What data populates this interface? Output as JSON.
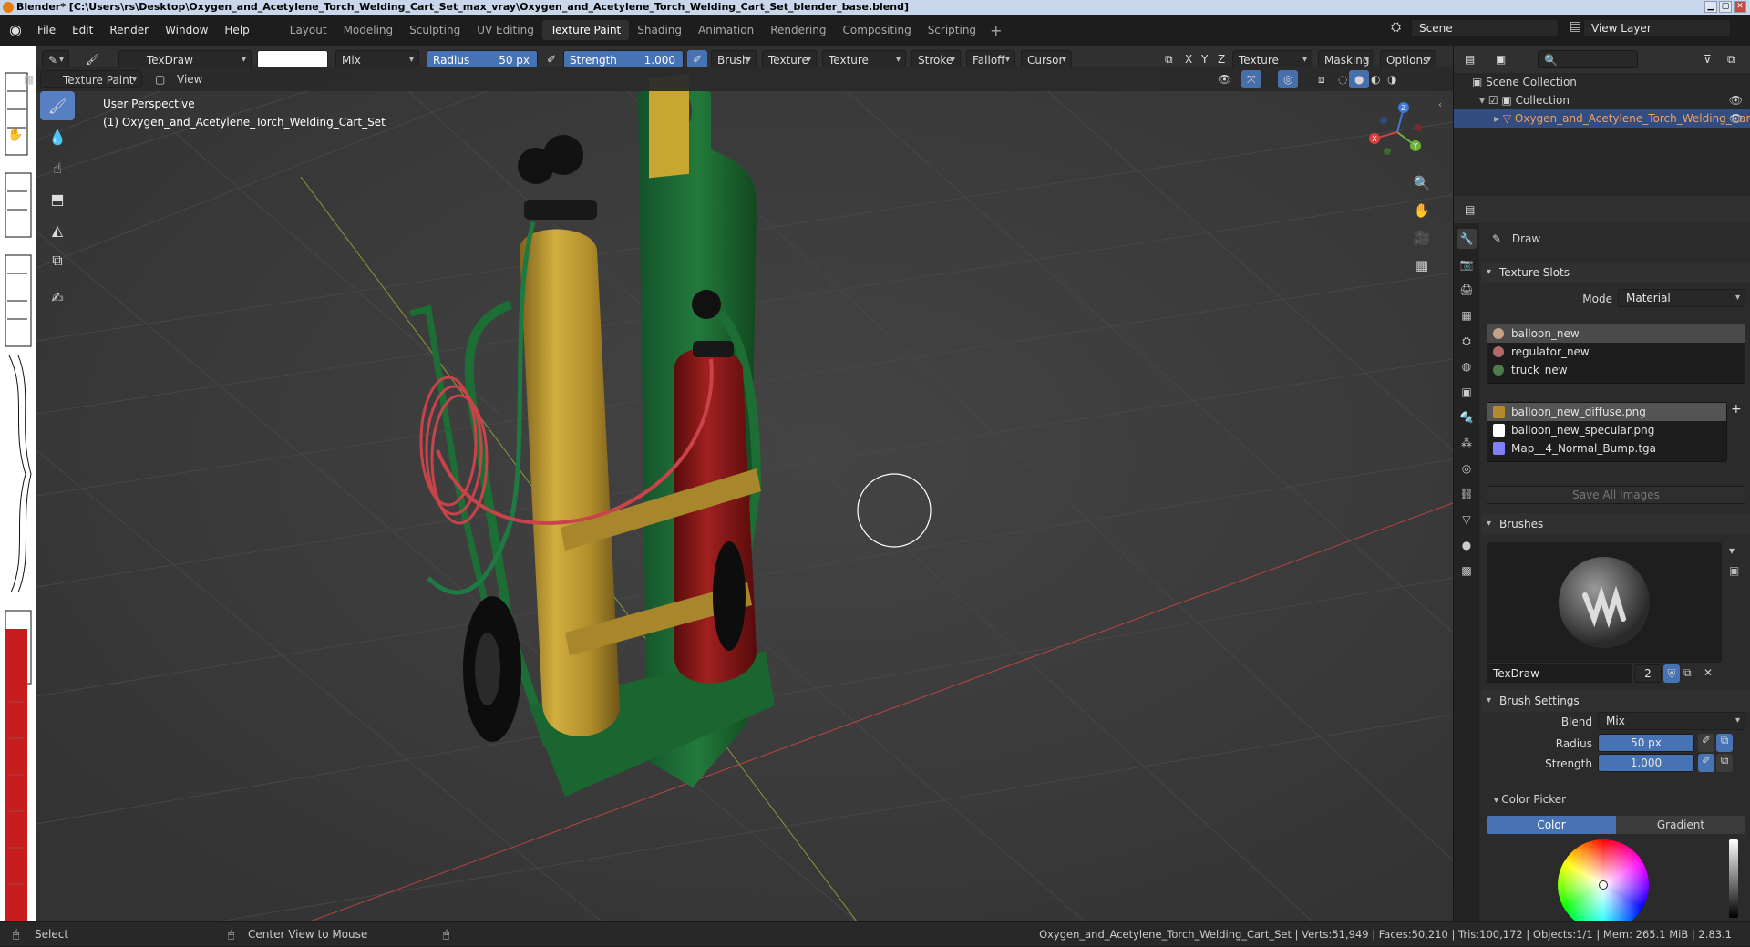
{
  "window": {
    "title": "Blender* [C:\\Users\\rs\\Desktop\\Oxygen_and_Acetylene_Torch_Welding_Cart_Set_max_vray\\Oxygen_and_Acetylene_Torch_Welding_Cart_Set_blender_base.blend]",
    "min": "▁",
    "max": "▢",
    "close": "✕"
  },
  "menu": [
    "File",
    "Edit",
    "Render",
    "Window",
    "Help"
  ],
  "workspaces": [
    "Layout",
    "Modeling",
    "Sculpting",
    "UV Editing",
    "Texture Paint",
    "Shading",
    "Animation",
    "Rendering",
    "Compositing",
    "Scripting"
  ],
  "active_workspace": "Texture Paint",
  "workspace_add": "+",
  "scene": {
    "label": "Scene",
    "view_layer": "View Layer"
  },
  "tool_header": {
    "brush_name": "TexDraw",
    "blend": "Mix",
    "radius_label": "Radius",
    "radius_value": "50 px",
    "strength_label": "Strength",
    "strength_value": "1.000",
    "menus": [
      "Brush",
      "Texture",
      "Texture Mask",
      "Stroke",
      "Falloff",
      "Cursor"
    ],
    "axes": [
      "X",
      "Y",
      "Z"
    ],
    "right_menus": [
      "Texture Slots",
      "Masking",
      "Options"
    ]
  },
  "sub_header": {
    "mode": "Texture Paint",
    "view": "View"
  },
  "viewport": {
    "perspective": "User Perspective",
    "object": "(1) Oxygen_and_Acetylene_Torch_Welding_Cart_Set",
    "gizmo": {
      "x": "X",
      "y": "Y",
      "z": "Z"
    }
  },
  "outliner": {
    "root": "Scene Collection",
    "collection": "Collection",
    "object": "Oxygen_and_Acetylene_Torch_Welding_Cart"
  },
  "properties": {
    "tool_name": "Draw",
    "texture_slots": {
      "title": "Texture Slots",
      "mode_label": "Mode",
      "mode_value": "Material",
      "materials": [
        {
          "name": "balloon_new",
          "color": "#c7a28a"
        },
        {
          "name": "regulator_new",
          "color": "#b06a6a"
        },
        {
          "name": "truck_new",
          "color": "#4d7d4d"
        }
      ],
      "images": [
        {
          "name": "balloon_new_diffuse.png",
          "color": "#b5892e"
        },
        {
          "name": "balloon_new_specular.png",
          "color": "#ffffff"
        },
        {
          "name": "Map__4_Normal_Bump.tga",
          "color": "#8080ff"
        }
      ],
      "add": "+",
      "save_all": "Save All Images"
    },
    "brushes": {
      "title": "Brushes",
      "brush_name": "TexDraw",
      "users": "2"
    },
    "brush_settings": {
      "title": "Brush Settings",
      "blend_label": "Blend",
      "blend_value": "Mix",
      "radius_label": "Radius",
      "radius_value": "50 px",
      "strength_label": "Strength",
      "strength_value": "1.000"
    },
    "color_picker": {
      "title": "Color Picker",
      "tab_color": "Color",
      "tab_gradient": "Gradient"
    }
  },
  "statusbar": {
    "select": "Select",
    "center": "Center View to Mouse",
    "info": "Oxygen_and_Acetylene_Torch_Welding_Cart_Set | Verts:51,949 | Faces:50,210 | Tris:100,172 | Objects:1/1 | Mem: 265.1 MiB | 2.83.1"
  },
  "colors": {
    "accent": "#4772b3",
    "selection": "#334d80",
    "tank_yellow": "#c7a032",
    "tank_red": "#8f1a1a",
    "frame_green": "#1f6b33"
  }
}
